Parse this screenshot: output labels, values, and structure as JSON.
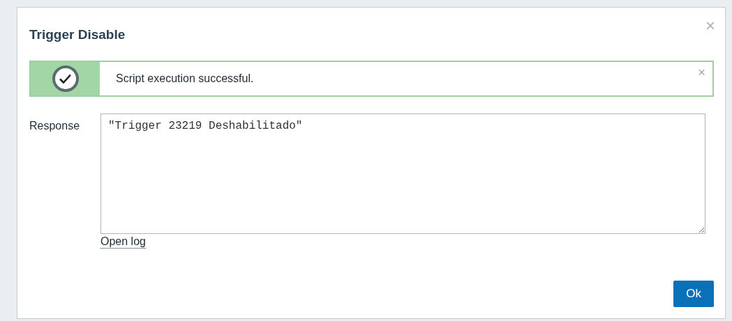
{
  "dialog": {
    "title": "Trigger Disable",
    "close": "×"
  },
  "message": {
    "kind": "success",
    "text": "Script execution successful.",
    "dismiss": "×"
  },
  "response": {
    "label": "Response",
    "value": "\"Trigger 23219 Deshabilitado\""
  },
  "link": "Open log",
  "buttons": [
    "Ok"
  ]
}
